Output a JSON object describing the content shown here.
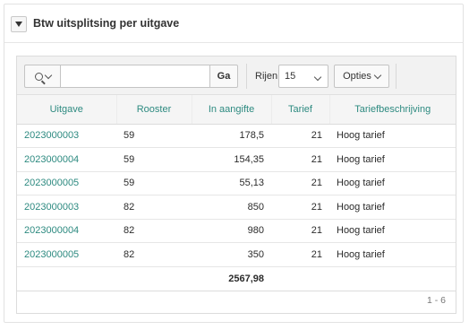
{
  "panel": {
    "title": "Btw uitsplitsing per uitgave"
  },
  "toolbar": {
    "search_placeholder": "",
    "go_label": "Ga",
    "rows_label": "Rijen",
    "rows_value": "15",
    "options_label": "Opties"
  },
  "table": {
    "columns": [
      "Uitgave",
      "Rooster",
      "In aangifte",
      "Tarief",
      "Tariefbeschrijving"
    ],
    "rows": [
      {
        "uitgave": "2023000003",
        "rooster": "59",
        "aangifte": "178,5",
        "tarief": "21",
        "beschrijving": "Hoog tarief"
      },
      {
        "uitgave": "2023000004",
        "rooster": "59",
        "aangifte": "154,35",
        "tarief": "21",
        "beschrijving": "Hoog tarief"
      },
      {
        "uitgave": "2023000005",
        "rooster": "59",
        "aangifte": "55,13",
        "tarief": "21",
        "beschrijving": "Hoog tarief"
      },
      {
        "uitgave": "2023000003",
        "rooster": "82",
        "aangifte": "850",
        "tarief": "21",
        "beschrijving": "Hoog tarief"
      },
      {
        "uitgave": "2023000004",
        "rooster": "82",
        "aangifte": "980",
        "tarief": "21",
        "beschrijving": "Hoog tarief"
      },
      {
        "uitgave": "2023000005",
        "rooster": "82",
        "aangifte": "350",
        "tarief": "21",
        "beschrijving": "Hoog tarief"
      }
    ],
    "total": "2567,98"
  },
  "pagination": "1 - 6",
  "colors": {
    "link": "#2d8a80",
    "header_bg": "#f5f5f5"
  }
}
